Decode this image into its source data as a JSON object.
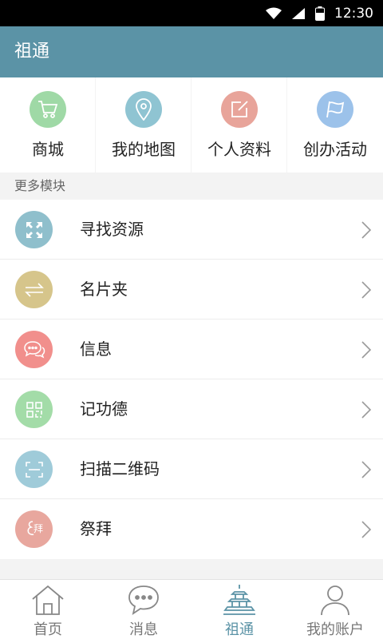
{
  "status_bar": {
    "time": "12:30"
  },
  "app_bar": {
    "title": "祖通"
  },
  "grid": {
    "items": [
      {
        "label": "商城",
        "icon": "cart-icon",
        "color": "#9fd9a6"
      },
      {
        "label": "我的地图",
        "icon": "location-pin-icon",
        "color": "#8fc4d2"
      },
      {
        "label": "个人资料",
        "icon": "edit-icon",
        "color": "#e8a49a"
      },
      {
        "label": "创办活动",
        "icon": "flag-icon",
        "color": "#9cc2ea"
      }
    ]
  },
  "section": {
    "title": "更多模块"
  },
  "list": {
    "items": [
      {
        "label": "寻找资源",
        "icon": "expand-arrows-icon",
        "color": "#8fbfcc"
      },
      {
        "label": "名片夹",
        "icon": "swap-arrows-icon",
        "color": "#d6c58b"
      },
      {
        "label": "信息",
        "icon": "chat-bubbles-icon",
        "color": "#f18f8c"
      },
      {
        "label": "记功德",
        "icon": "grid-blocks-icon",
        "color": "#a3dca8"
      },
      {
        "label": "扫描二维码",
        "icon": "scan-frame-icon",
        "color": "#9fcbd9"
      },
      {
        "label": "祭拜",
        "icon": "worship-icon",
        "color": "#e8a79e",
        "badge": "拜"
      }
    ]
  },
  "tab_bar": {
    "items": [
      {
        "label": "首页",
        "icon": "home-icon",
        "active": false
      },
      {
        "label": "消息",
        "icon": "message-icon",
        "active": false
      },
      {
        "label": "祖通",
        "icon": "pagoda-icon",
        "active": true
      },
      {
        "label": "我的账户",
        "icon": "person-icon",
        "active": false
      }
    ]
  },
  "colors": {
    "accent": "#5b93a6",
    "background": "#f3f3f3"
  }
}
